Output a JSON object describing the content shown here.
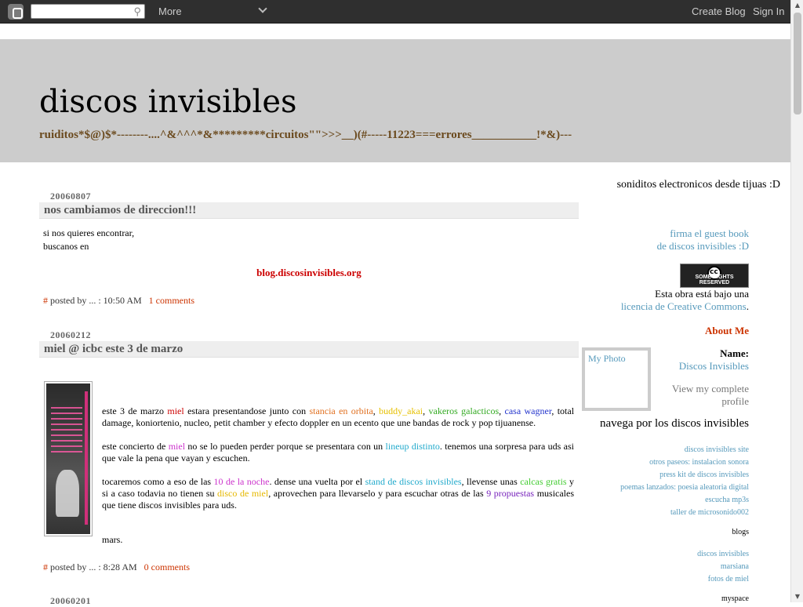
{
  "navbar": {
    "more_label": "More",
    "create_blog_label": "Create Blog",
    "sign_in_label": "Sign In"
  },
  "header": {
    "title": "discos invisibles",
    "description": "ruiditos*$@)$*--------....^&^^^*&*********circuitos\"\">>>__)(#-----11223===errores___________!*&)---"
  },
  "posts": [
    {
      "date": "20060807",
      "title": "nos cambiamos de direccion!!!",
      "line1": "si nos quieres encontrar,",
      "line2": "buscanos en",
      "link": "blog.discosinvisibles.org",
      "hash": "#",
      "posted_by": "posted by ... : 10:50 AM",
      "comments": "1 comments"
    },
    {
      "date": "20060212",
      "title": "miel @ icbc este 3 de marzo",
      "p1": {
        "a": "este 3 de marzo ",
        "miel": "miel",
        "b": " estara presentandose junto con ",
        "stancia": "stancia en orbita",
        "c": ", ",
        "buddy": "buddy_akai",
        "d": ", ",
        "vakeros": "vakeros galacticos",
        "e": ", ",
        "casa": "casa wagner",
        "f": ", total damage, koniortenio, nucleo, petit chamber y efecto doppler en un ecento que une bandas de rock y pop tijuanense."
      },
      "p2": {
        "a": "este concierto de ",
        "miel": "miel",
        "b": " no se lo pueden perder porque se presentara con un ",
        "lineup": "lineup distinto",
        "c": ". tenemos una sorpresa para uds asi que vale la pena que vayan y escuchen."
      },
      "p3": {
        "a": "tocaremos como a eso de las ",
        "noche": "10 de la noche",
        "b": ". dense una vuelta por el ",
        "stand": "stand de discos invisibles",
        "c": ", llevense unas ",
        "calcas": "calcas gratis",
        "d": " y si a caso todavia no tienen su ",
        "disco": "disco de miel",
        "e": ", aprovechen para llevarselo y para escuchar otras de las ",
        "propuestas": "9 propuestas",
        "f": " musicales que tiene discos invisibles para uds."
      },
      "signature": "mars.",
      "hash": "#",
      "posted_by": "posted by ... : 8:28 AM",
      "comments": "0 comments"
    },
    {
      "date": "20060201"
    }
  ],
  "sidebar": {
    "tagline": "soniditos electronicos desde tijuas :D",
    "guestbook1": "firma el guest book",
    "guestbook2": "de discos invisibles :D",
    "cc_badge": "SOME RIGHTS RESERVED",
    "license_text": "Esta obra está bajo una",
    "license_link": "licencia de Creative Commons",
    "license_dot": ".",
    "about_title": "About Me",
    "photo_alt": "My Photo",
    "name_label": "Name:",
    "name_value": "Discos Invisibles",
    "profile1": "View my complete",
    "profile2": "profile",
    "navega_title": "navega por los discos invisibles",
    "nav_links": [
      "discos invisibles site",
      "otros paseos: instalacion sonora",
      "press kit de discos invisibles",
      "poemas lanzados: poesia aleatoria digital",
      "escucha mp3s",
      "taller de microsonido002"
    ],
    "blogs_title": "blogs",
    "blog_links": [
      "discos invisibles",
      "marsiana",
      "fotos de miel"
    ],
    "myspace_title": "myspace"
  },
  "colors": {
    "header_bg": "#cccccc",
    "navbar_bg": "#2f2f2f",
    "accent": "#cc3300",
    "link": "#5599bb"
  }
}
